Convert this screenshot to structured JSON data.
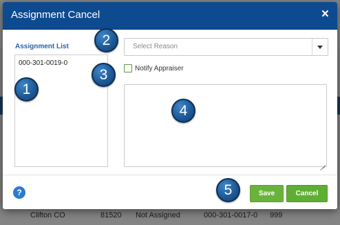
{
  "background": {
    "row_cells": [
      "Clifton CO",
      "81520",
      "Not Assigned",
      "000-301-0017-0",
      "999"
    ]
  },
  "modal": {
    "title": "Assignment Cancel",
    "close_icon": "×",
    "assignment_list_label": "Assignment List",
    "assignment_items": [
      "000-301-0019-0"
    ],
    "reason_select": {
      "placeholder": "Select Reason"
    },
    "notify_appraiser_label": "Notify Appraiser",
    "notify_appraiser_checked": false,
    "notes_value": "",
    "help_icon": "?",
    "save_label": "Save",
    "cancel_label": "Cancel"
  },
  "callouts": [
    "1",
    "2",
    "3",
    "4",
    "5"
  ],
  "colors": {
    "header": "#0e4a8f",
    "accent_blue": "#2a64a6",
    "save_green": "#69b33a",
    "cancel_green": "#5fae34"
  }
}
